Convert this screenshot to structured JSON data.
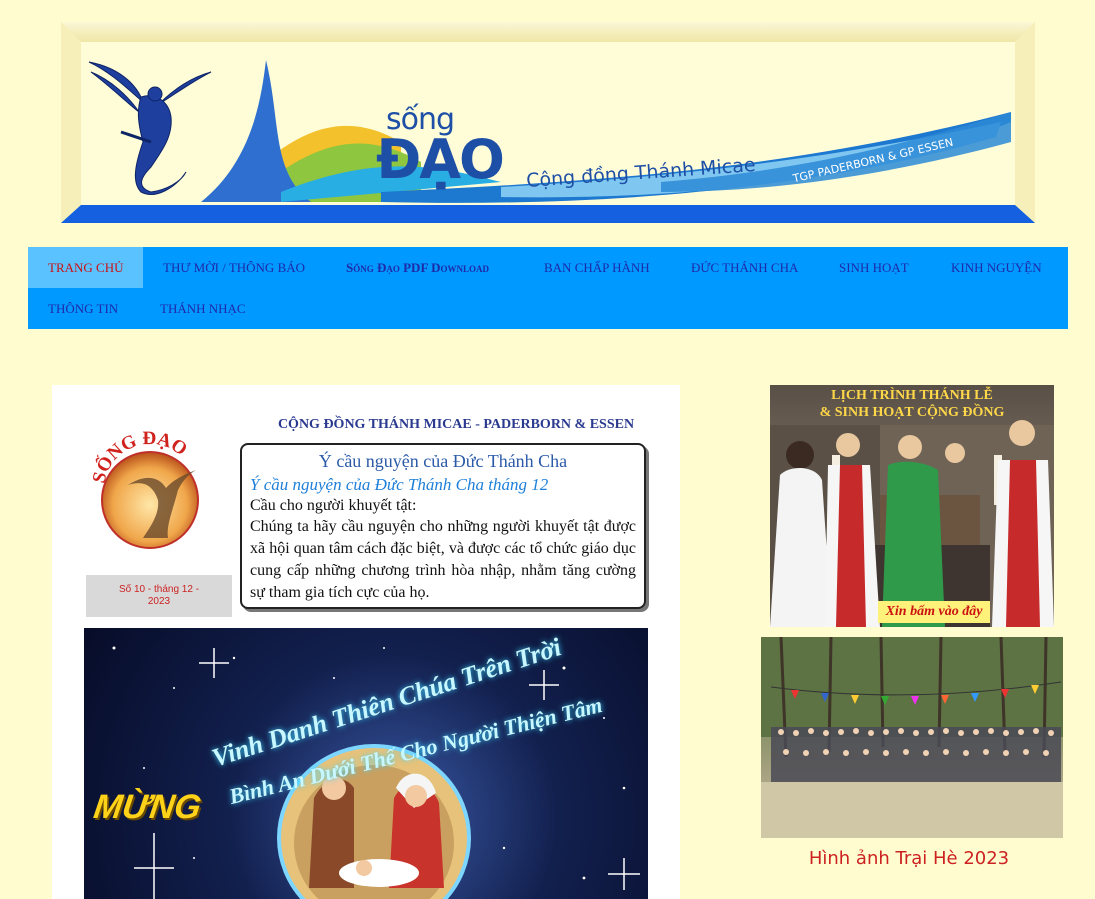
{
  "banner": {
    "logo_top": "sống",
    "logo_main": "ĐẠO",
    "subtitle": "Cộng đồng Thánh Micae",
    "tagline": "TGP PADERBORN & GP ESSEN"
  },
  "nav": {
    "row1": [
      "TRANG CHỦ",
      "THƯ MỜI / THÔNG BÁO",
      "Sống Đạo PDF Download",
      "BAN CHẤP HÀNH",
      "ĐỨC THÁNH CHA",
      "SINH HOẠT",
      "KINH NGUYỆN"
    ],
    "row2": [
      "THÔNG TIN",
      "THÁNH NHẠC"
    ],
    "active": "TRANG CHỦ"
  },
  "post": {
    "header": "CỘNG ĐỒNG THÁNH MICAE - PADERBORN & ESSEN",
    "seal_text": "SỐNG ĐẠO",
    "issue": "Số 10 - tháng 12 - 2023",
    "prayer": {
      "title": "Ý cầu nguyện của Đức Thánh Cha",
      "subtitle": "Ý cầu nguyện của Đức Thánh Cha tháng 12",
      "intro": "Cầu cho người khuyết tật:",
      "body": "Chúng ta hãy cầu nguyện cho những người khuyết tật được xã hội quan tâm cách đặc biệt, và được các tổ chức giáo dục cung cấp những chương trình hòa nhập, nhằm tăng cường sự tham gia tích cực của họ."
    },
    "xmas": {
      "line1": "Vinh Danh Thiên Chúa Trên Trời",
      "line2": "Bình An Dưới Thế Cho Người Thiện Tâm",
      "greeting": "MỪNG"
    }
  },
  "sidebar": {
    "schedule_title_1": "LỊCH TRÌNH THÁNH LỄ",
    "schedule_title_2": "& SINH HOẠT CỘNG ĐỒNG",
    "schedule_button": "Xin bấm vào đây",
    "camp_caption": "Hình ảnh Trại Hè 2023"
  },
  "colors": {
    "page_bg": "#fffdd0",
    "nav_bg": "#0099ff",
    "nav_active_bg": "#59c2ff",
    "nav_text": "#1e2aa8",
    "active_text": "#cc1111"
  }
}
